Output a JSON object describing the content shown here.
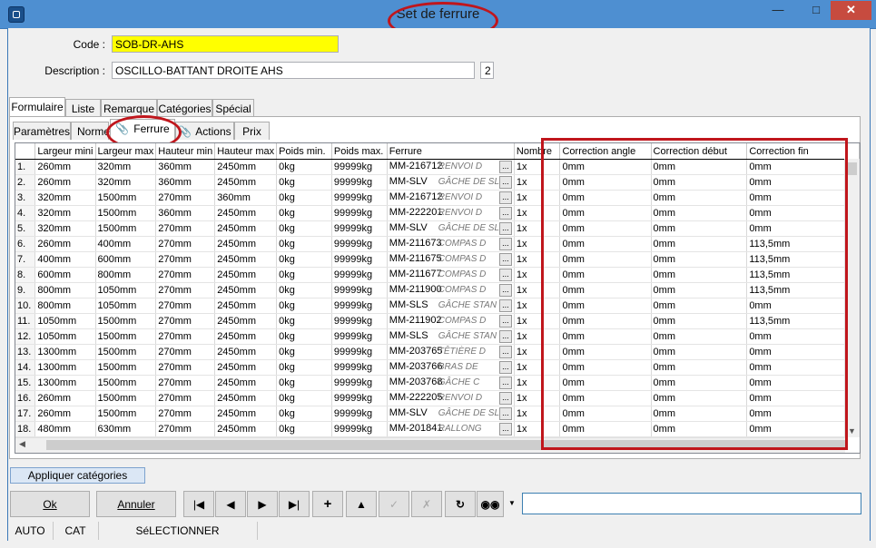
{
  "window": {
    "title": "Set de ferrure"
  },
  "form": {
    "code_label": "Code :",
    "code_value": "SOB-DR-AHS",
    "description_label": "Description :",
    "description_value": "OSCILLO-BATTANT DROITE AHS",
    "description_count": "2"
  },
  "tabs_main": [
    "Formulaire",
    "Liste",
    "Remarque",
    "Catégories",
    "Spécial"
  ],
  "tabs_sub": [
    "Paramètres",
    "Norme",
    "Ferrure",
    "Actions",
    "Prix"
  ],
  "grid": {
    "columns": [
      "",
      "Largeur mini",
      "Largeur max",
      "Hauteur min",
      "Hauteur max",
      "Poids min.",
      "Poids max.",
      "Ferrure",
      "Nombre",
      "Correction angle",
      "Correction début",
      "Correction fin"
    ],
    "rows": [
      [
        "1.",
        "260mm",
        "320mm",
        "360mm",
        "2450mm",
        "0kg",
        "99999kg",
        "MM-216712",
        "RENVOI D",
        "1x",
        "0mm",
        "0mm",
        "0mm"
      ],
      [
        "2.",
        "260mm",
        "320mm",
        "360mm",
        "2450mm",
        "0kg",
        "99999kg",
        "MM-SLV",
        "GÂCHE DE SL",
        "1x",
        "0mm",
        "0mm",
        "0mm"
      ],
      [
        "3.",
        "320mm",
        "1500mm",
        "270mm",
        "360mm",
        "0kg",
        "99999kg",
        "MM-216712",
        "RENVOI D",
        "1x",
        "0mm",
        "0mm",
        "0mm"
      ],
      [
        "4.",
        "320mm",
        "1500mm",
        "360mm",
        "2450mm",
        "0kg",
        "99999kg",
        "MM-222201",
        "RENVOI D",
        "1x",
        "0mm",
        "0mm",
        "0mm"
      ],
      [
        "5.",
        "320mm",
        "1500mm",
        "270mm",
        "2450mm",
        "0kg",
        "99999kg",
        "MM-SLV",
        "GÂCHE DE SL",
        "1x",
        "0mm",
        "0mm",
        "0mm"
      ],
      [
        "6.",
        "260mm",
        "400mm",
        "270mm",
        "2450mm",
        "0kg",
        "99999kg",
        "MM-211673",
        "COMPAS D",
        "1x",
        "0mm",
        "0mm",
        "113,5mm"
      ],
      [
        "7.",
        "400mm",
        "600mm",
        "270mm",
        "2450mm",
        "0kg",
        "99999kg",
        "MM-211675",
        "COMPAS D",
        "1x",
        "0mm",
        "0mm",
        "113,5mm"
      ],
      [
        "8.",
        "600mm",
        "800mm",
        "270mm",
        "2450mm",
        "0kg",
        "99999kg",
        "MM-211677",
        "COMPAS D",
        "1x",
        "0mm",
        "0mm",
        "113,5mm"
      ],
      [
        "9.",
        "800mm",
        "1050mm",
        "270mm",
        "2450mm",
        "0kg",
        "99999kg",
        "MM-211900",
        "COMPAS D",
        "1x",
        "0mm",
        "0mm",
        "113,5mm"
      ],
      [
        "10.",
        "800mm",
        "1050mm",
        "270mm",
        "2450mm",
        "0kg",
        "99999kg",
        "MM-SLS",
        "GÂCHE STAN",
        "1x",
        "0mm",
        "0mm",
        "0mm"
      ],
      [
        "11.",
        "1050mm",
        "1500mm",
        "270mm",
        "2450mm",
        "0kg",
        "99999kg",
        "MM-211902",
        "COMPAS D",
        "1x",
        "0mm",
        "0mm",
        "113,5mm"
      ],
      [
        "12.",
        "1050mm",
        "1500mm",
        "270mm",
        "2450mm",
        "0kg",
        "99999kg",
        "MM-SLS",
        "GÂCHE STAN",
        "1x",
        "0mm",
        "0mm",
        "0mm"
      ],
      [
        "13.",
        "1300mm",
        "1500mm",
        "270mm",
        "2450mm",
        "0kg",
        "99999kg",
        "MM-203765",
        "TÊTIÈRE D",
        "1x",
        "0mm",
        "0mm",
        "0mm"
      ],
      [
        "14.",
        "1300mm",
        "1500mm",
        "270mm",
        "2450mm",
        "0kg",
        "99999kg",
        "MM-203766",
        "BRAS DE",
        "1x",
        "0mm",
        "0mm",
        "0mm"
      ],
      [
        "15.",
        "1300mm",
        "1500mm",
        "270mm",
        "2450mm",
        "0kg",
        "99999kg",
        "MM-203768",
        "GÂCHE C",
        "1x",
        "0mm",
        "0mm",
        "0mm"
      ],
      [
        "16.",
        "260mm",
        "1500mm",
        "270mm",
        "2450mm",
        "0kg",
        "99999kg",
        "MM-222205",
        "RENVOI D",
        "1x",
        "0mm",
        "0mm",
        "0mm"
      ],
      [
        "17.",
        "260mm",
        "1500mm",
        "270mm",
        "2450mm",
        "0kg",
        "99999kg",
        "MM-SLV",
        "GÂCHE DE SL",
        "1x",
        "0mm",
        "0mm",
        "0mm"
      ],
      [
        "18.",
        "480mm",
        "630mm",
        "270mm",
        "2450mm",
        "0kg",
        "99999kg",
        "MM-201841",
        "RALLONG",
        "1x",
        "0mm",
        "0mm",
        "0mm"
      ]
    ]
  },
  "buttons": {
    "apply_categories": "Appliquer catégories",
    "ok": "Ok",
    "cancel": "Annuler"
  },
  "status": [
    "AUTO",
    "CAT",
    "SéLECTIONNER"
  ],
  "colors": {
    "highlight_yellow": "#ffff00",
    "annotation_red": "#c0161c",
    "title_blue": "#4e8fd1"
  },
  "icons": [
    "first-icon",
    "previous-icon",
    "next-icon",
    "last-icon",
    "add-icon",
    "move-up-icon",
    "confirm-icon",
    "discard-icon",
    "refresh-icon",
    "search-binoculars-icon"
  ]
}
